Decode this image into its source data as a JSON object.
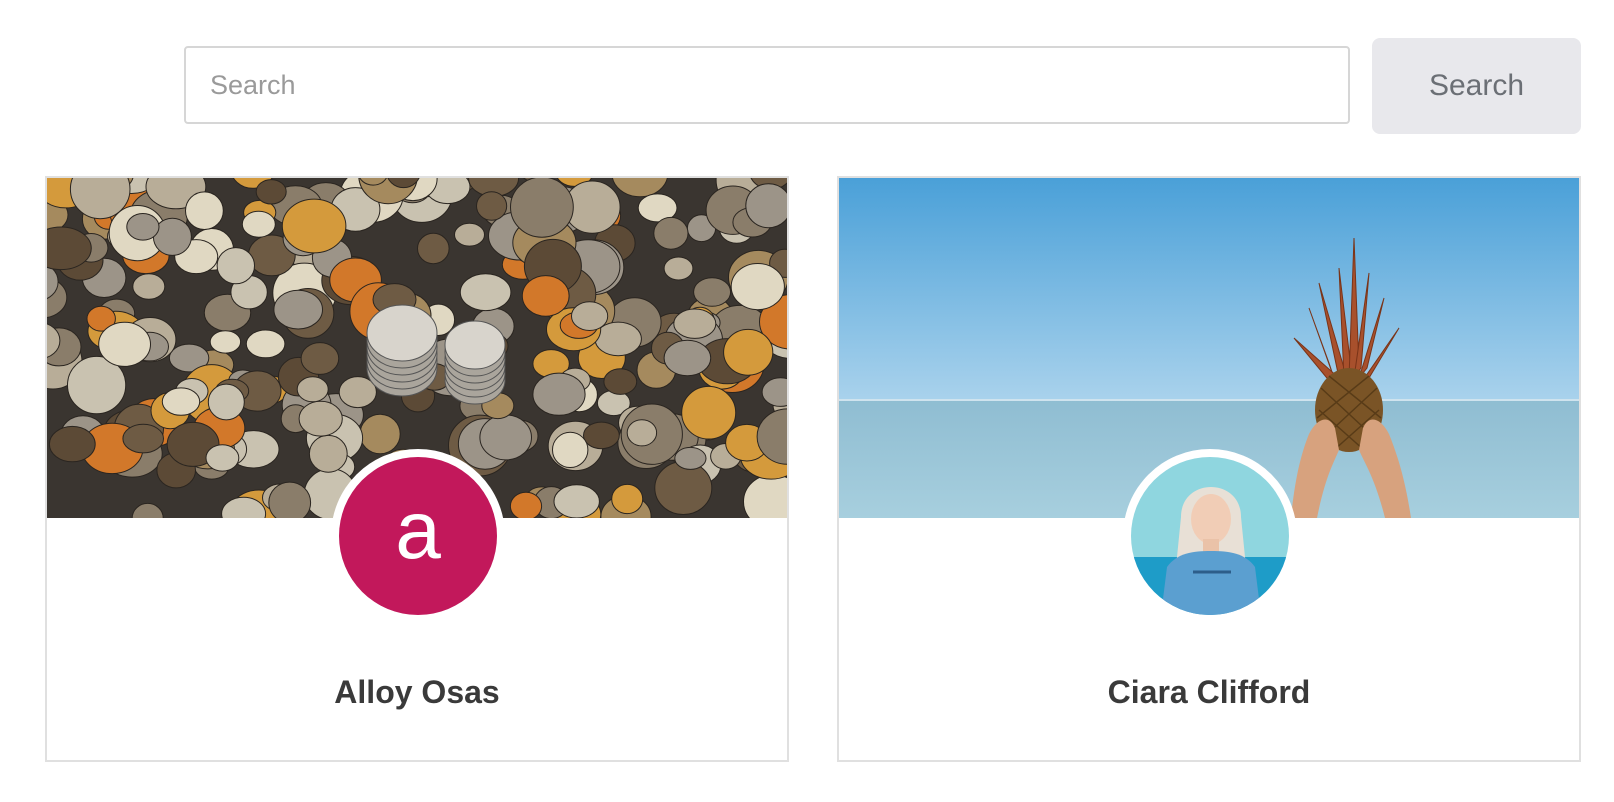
{
  "search": {
    "placeholder": "Search",
    "value": "",
    "button_label": "Search"
  },
  "profiles": [
    {
      "name": "Alloy Osas",
      "avatar_type": "letter",
      "avatar_letter": "a",
      "avatar_color": "#c2185b",
      "cover": "coins-photo"
    },
    {
      "name": "Ciara Clifford",
      "avatar_type": "photo",
      "avatar_photo": "woman-portrait-photo",
      "cover": "ocean-pineapple-photo"
    }
  ]
}
